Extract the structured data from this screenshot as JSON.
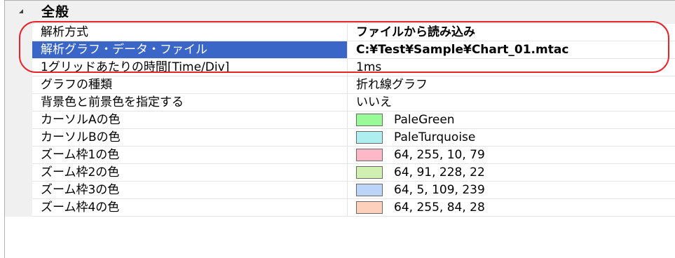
{
  "group": {
    "title": "全般"
  },
  "properties": [
    {
      "name": "解析方式",
      "value": "ファイルから読み込み",
      "bold": true,
      "selected": false
    },
    {
      "name": "解析グラフ・データ・ファイル",
      "value": "C:¥Test¥Sample¥Chart_01.mtac",
      "bold": true,
      "selected": true
    },
    {
      "name": "1グリッドあたりの時間[Time/Div]",
      "value": "1ms",
      "bold": false,
      "selected": false
    },
    {
      "name": "グラフの種類",
      "value": "折れ線グラフ",
      "bold": false,
      "selected": false
    },
    {
      "name": "背景色と前景色を指定する",
      "value": "いいえ",
      "bold": false,
      "selected": false
    },
    {
      "name": "カーソルAの色",
      "value": "PaleGreen",
      "color": "#98fb98",
      "selected": false
    },
    {
      "name": "カーソルBの色",
      "value": "PaleTurquoise",
      "color": "#afeeee",
      "selected": false
    },
    {
      "name": "ズーム枠1の色",
      "value": "64, 255, 10, 79",
      "color": "#ffb8c8",
      "selected": false
    },
    {
      "name": "ズーム枠2の色",
      "value": "64, 91, 228, 22",
      "color": "#cff0b0",
      "selected": false
    },
    {
      "name": "ズーム枠3の色",
      "value": "64, 5, 109, 239",
      "color": "#bcd4f8",
      "selected": false
    },
    {
      "name": "ズーム枠4の色",
      "value": "64, 255, 84, 28",
      "color": "#fdd0bc",
      "selected": false
    }
  ],
  "colors": {
    "selection": "#3a66c8",
    "highlight_outline": "#e8242b"
  }
}
